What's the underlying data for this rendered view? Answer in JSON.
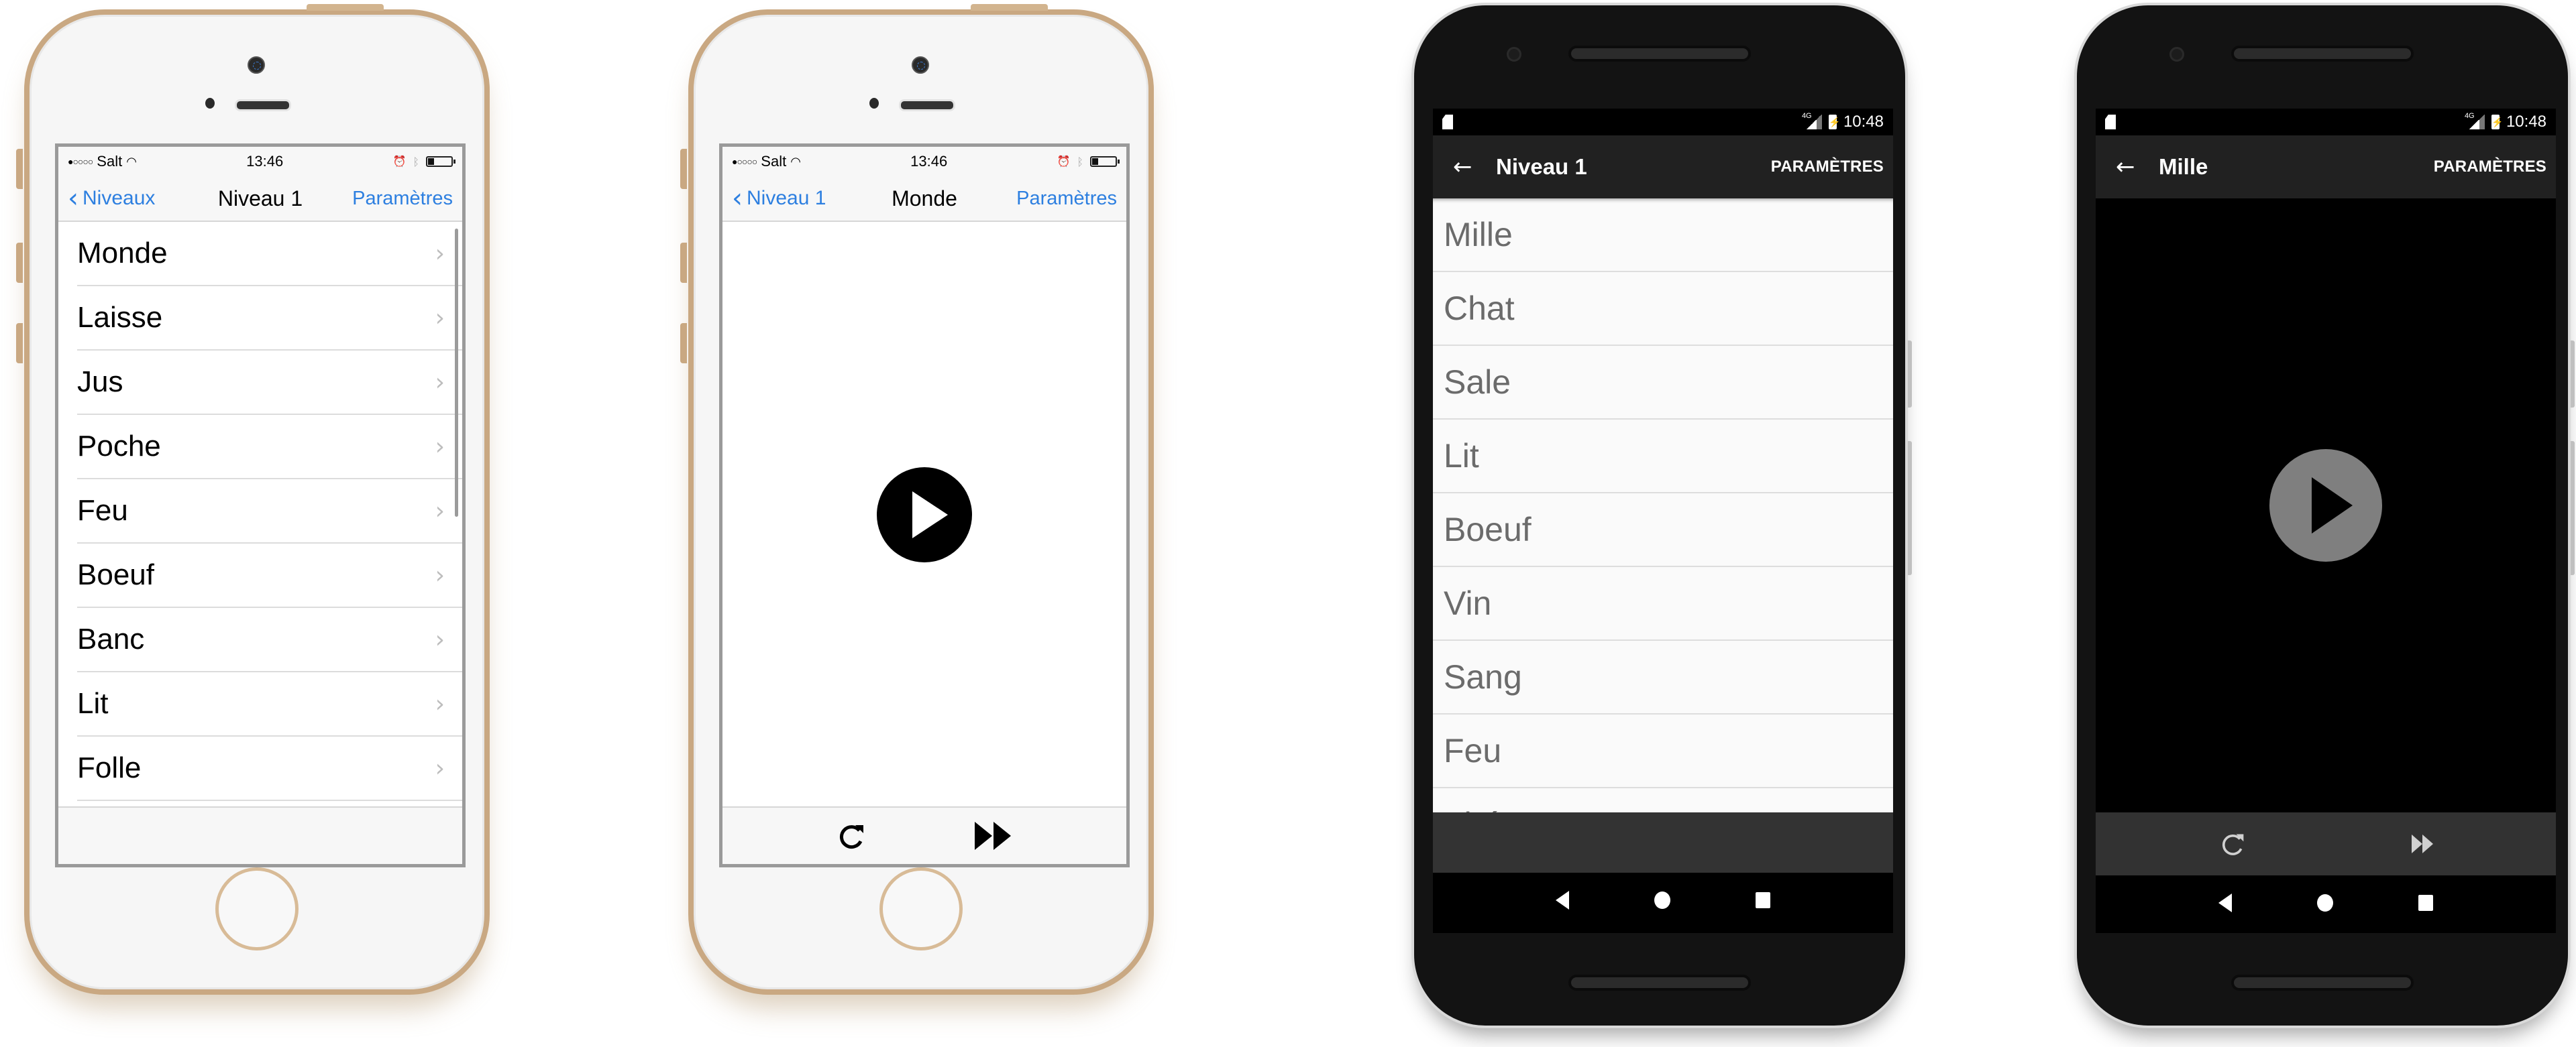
{
  "colors": {
    "ios_accent": "#2d7fe0",
    "ios_bezel_gold": "#c9a882",
    "android_toolbar": "#212121",
    "android_list_text": "#6b6b6b",
    "android_play_disc": "#7f7f7f"
  },
  "ios_list_screen": {
    "status": {
      "carrier": "Salt",
      "signal_dots": "●○○○○",
      "time": "13:46",
      "battery_level_percent": 25
    },
    "nav": {
      "back_label": "Niveaux",
      "title": "Niveau 1",
      "action_label": "Paramètres"
    },
    "items": [
      "Monde",
      "Laisse",
      "Jus",
      "Poche",
      "Feu",
      "Boeuf",
      "Banc",
      "Lit",
      "Folle"
    ]
  },
  "ios_player_screen": {
    "status": {
      "carrier": "Salt",
      "signal_dots": "●○○○○",
      "time": "13:46",
      "battery_level_percent": 25
    },
    "nav": {
      "back_label": "Niveau 1",
      "title": "Monde",
      "action_label": "Paramètres"
    },
    "icons": {
      "play": "play-circle-icon",
      "replay": "replay-icon",
      "skip": "fast-forward-icon"
    }
  },
  "android_list_screen": {
    "status": {
      "network": "4G",
      "time": "10:48"
    },
    "toolbar": {
      "title": "Niveau 1",
      "action_label": "PARAMÈTRES"
    },
    "items": [
      "Mille",
      "Chat",
      "Sale",
      "Lit",
      "Boeuf",
      "Vin",
      "Sang",
      "Feu",
      "Thé"
    ]
  },
  "android_player_screen": {
    "status": {
      "network": "4G",
      "time": "10:48"
    },
    "toolbar": {
      "title": "Mille",
      "action_label": "PARAMÈTRES"
    },
    "icons": {
      "play": "play-circle-icon",
      "replay": "replay-icon",
      "skip": "fast-forward-icon"
    }
  }
}
